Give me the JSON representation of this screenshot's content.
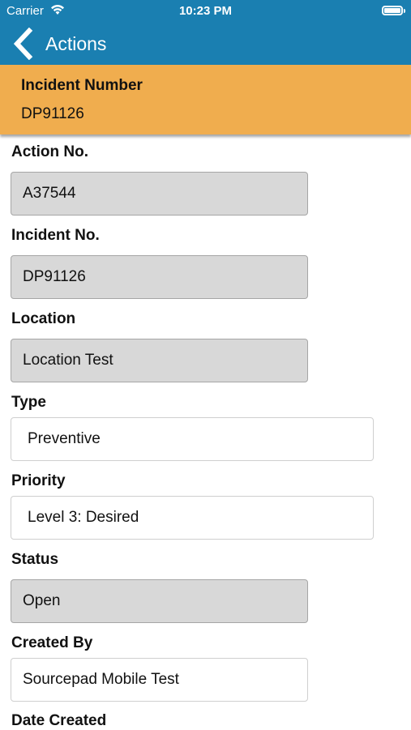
{
  "status_bar": {
    "carrier": "Carrier",
    "time": "10:23 PM",
    "icons": [
      "wifi-icon",
      "battery-icon"
    ]
  },
  "nav": {
    "back_icon": "chevron-left-icon",
    "title": "Actions",
    "background": "#1a7fb1"
  },
  "banner": {
    "label": "Incident Number",
    "value": "DP91126",
    "background": "#f0ad4e"
  },
  "form": {
    "action_no": {
      "label": "Action No.",
      "value": "A37544"
    },
    "incident_no": {
      "label": "Incident No.",
      "value": "DP91126"
    },
    "location": {
      "label": "Location",
      "value": "Location Test"
    },
    "type": {
      "label": "Type",
      "value": "Preventive"
    },
    "priority": {
      "label": "Priority",
      "value": "Level 3: Desired"
    },
    "status": {
      "label": "Status",
      "value": "Open"
    },
    "created_by": {
      "label": "Created By",
      "value": "Sourcepad Mobile Test"
    },
    "date_created": {
      "label": "Date Created"
    }
  }
}
